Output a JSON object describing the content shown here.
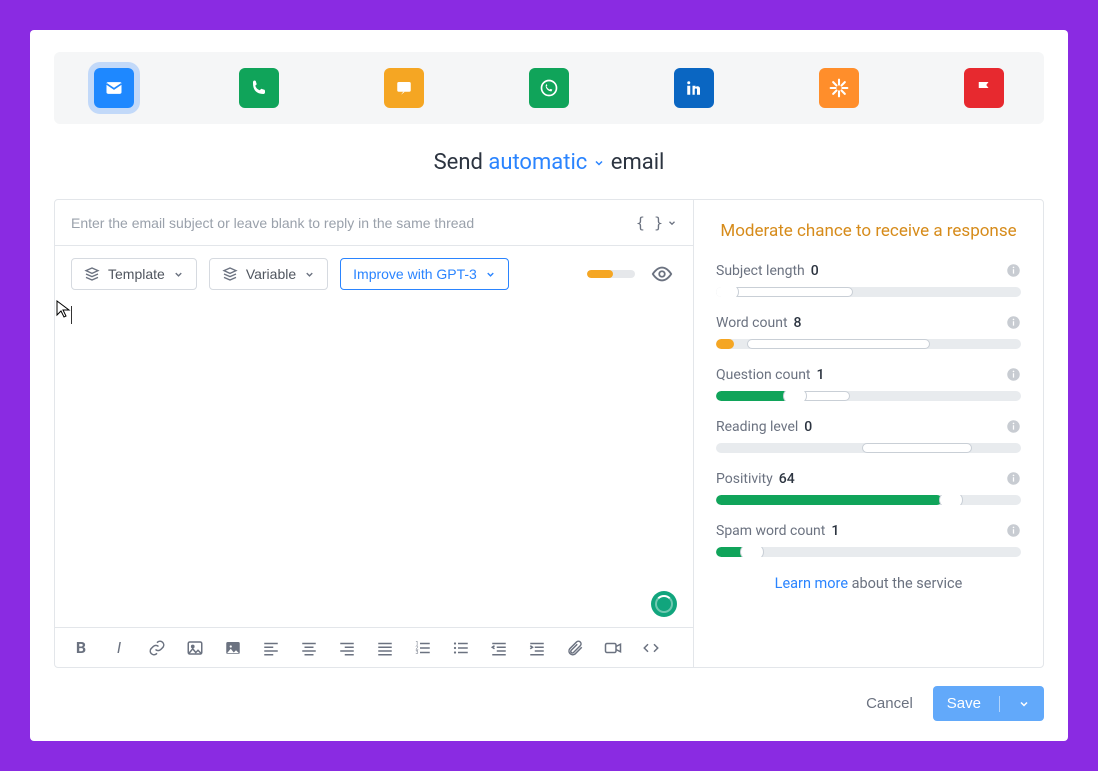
{
  "channels": [
    {
      "name": "email",
      "active": true
    },
    {
      "name": "phone",
      "active": false
    },
    {
      "name": "sms",
      "active": false
    },
    {
      "name": "whatsapp",
      "active": false
    },
    {
      "name": "linkedin",
      "active": false
    },
    {
      "name": "zapier",
      "active": false
    },
    {
      "name": "flag",
      "active": false
    }
  ],
  "heading": {
    "pre": "Send",
    "mode": "automatic",
    "post": "email"
  },
  "subject": {
    "placeholder": "Enter the email subject or leave blank to reply in the same thread",
    "value": ""
  },
  "tools": {
    "template": "Template",
    "variable": "Variable",
    "gpt": "Improve with GPT-3"
  },
  "analysis": {
    "title": "Moderate chance to receive a response",
    "metrics": [
      {
        "key": "subject",
        "label": "Subject length",
        "value": "0"
      },
      {
        "key": "words",
        "label": "Word count",
        "value": "8"
      },
      {
        "key": "question",
        "label": "Question count",
        "value": "1"
      },
      {
        "key": "reading",
        "label": "Reading level",
        "value": "0"
      },
      {
        "key": "positivity",
        "label": "Positivity",
        "value": "64"
      },
      {
        "key": "spam",
        "label": "Spam word count",
        "value": "1"
      }
    ],
    "learn_link": "Learn more",
    "learn_rest": "about the service"
  },
  "footer": {
    "cancel": "Cancel",
    "save": "Save"
  }
}
